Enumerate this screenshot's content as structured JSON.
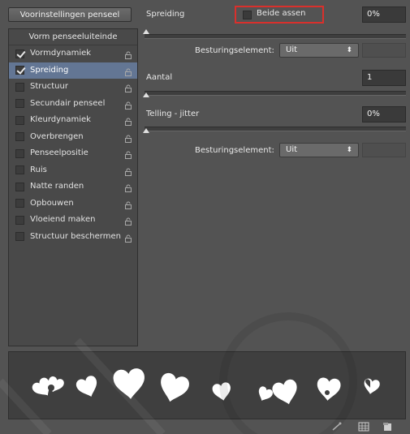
{
  "left": {
    "preset_button": "Voorinstellingen penseel",
    "header": "Vorm penseeluiteinde",
    "items": [
      {
        "label": "Vormdynamiek",
        "checked": true,
        "selected": false
      },
      {
        "label": "Spreiding",
        "checked": true,
        "selected": true
      },
      {
        "label": "Structuur",
        "checked": false,
        "selected": false
      },
      {
        "label": "Secundair penseel",
        "checked": false,
        "selected": false
      },
      {
        "label": "Kleurdynamiek",
        "checked": false,
        "selected": false
      },
      {
        "label": "Overbrengen",
        "checked": false,
        "selected": false
      },
      {
        "label": "Penseelpositie",
        "checked": false,
        "selected": false
      },
      {
        "label": "Ruis",
        "checked": false,
        "selected": false
      },
      {
        "label": "Natte randen",
        "checked": false,
        "selected": false
      },
      {
        "label": "Opbouwen",
        "checked": false,
        "selected": false
      },
      {
        "label": "Vloeiend maken",
        "checked": false,
        "selected": false
      },
      {
        "label": "Structuur beschermen",
        "checked": false,
        "selected": false
      }
    ]
  },
  "right": {
    "spreiding_label": "Spreiding",
    "both_axes_label": "Beide assen",
    "spreiding_value": "0%",
    "control1_label": "Besturingselement:",
    "control1_value": "Uit",
    "count_label": "Aantal",
    "count_value": "1",
    "count_jitter_label": "Telling - jitter",
    "count_jitter_value": "0%",
    "control2_label": "Besturingselement:",
    "control2_value": "Uit"
  },
  "bottom_icons": [
    "create-new-brush-icon",
    "grid-icon",
    "new-preset-icon"
  ],
  "colors": {
    "selection": "#637694",
    "highlight_border": "#d9302c"
  }
}
